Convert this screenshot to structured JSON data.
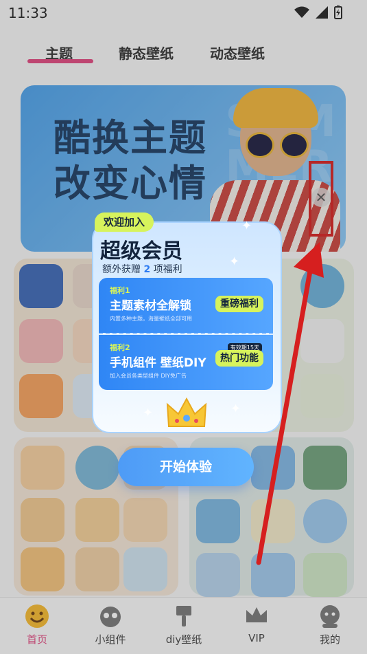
{
  "status_bar": {
    "time": "11:33"
  },
  "tabs": [
    {
      "label": "主题",
      "active": true
    },
    {
      "label": "静态壁纸",
      "active": false
    },
    {
      "label": "动态壁纸",
      "active": false
    }
  ],
  "banner": {
    "line1": "酷换主题",
    "line2": "改变心情",
    "bg_line1": "SUM",
    "bg_line2": "MER",
    "close_icon": "close-icon"
  },
  "modal": {
    "tag": "欢迎加入",
    "title": "超级会员",
    "subtitle_prefix": "额外获赠",
    "subtitle_count": "2",
    "subtitle_suffix": "项福利",
    "benefits": [
      {
        "label": "福利1",
        "title": "主题素材全解锁",
        "desc": "内置多种主题，海量壁纸全部可用",
        "pill": "重磅福利",
        "mini_tag": ""
      },
      {
        "label": "福利2",
        "title": "手机组件 壁纸DIY",
        "desc": "加入会员各类型组件 DIY免广告",
        "pill": "热门功能",
        "mini_tag": "有效期15天"
      }
    ],
    "cta": "开始体验"
  },
  "bottom_nav": [
    {
      "label": "首页",
      "icon": "smiley-icon",
      "active": true
    },
    {
      "label": "小组件",
      "icon": "widget-icon",
      "active": false
    },
    {
      "label": "diy壁纸",
      "icon": "brush-icon",
      "active": false
    },
    {
      "label": "VIP",
      "icon": "crown-icon",
      "active": false
    },
    {
      "label": "我的",
      "icon": "profile-icon",
      "active": false
    }
  ],
  "colors": {
    "accent": "#e0467e",
    "modal_blue": "#2f86f5",
    "highlight": "#d7f35c",
    "annotation": "#d61f1f"
  }
}
